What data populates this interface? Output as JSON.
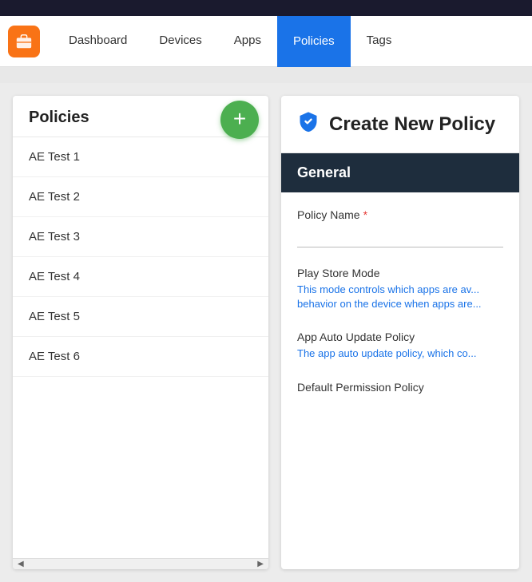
{
  "topbar": {
    "visible": true
  },
  "nav": {
    "logo_icon": "briefcase-icon",
    "links": [
      {
        "label": "Dashboard",
        "active": false
      },
      {
        "label": "Devices",
        "active": false
      },
      {
        "label": "Apps",
        "active": false
      },
      {
        "label": "Policies",
        "active": true
      },
      {
        "label": "Tags",
        "active": false
      }
    ]
  },
  "policies_panel": {
    "title": "Policies",
    "add_button_label": "+",
    "items": [
      {
        "label": "AE Test 1"
      },
      {
        "label": "AE Test 2"
      },
      {
        "label": "AE Test 3"
      },
      {
        "label": "AE Test 4"
      },
      {
        "label": "AE Test 5"
      },
      {
        "label": "AE Test 6"
      }
    ]
  },
  "create_policy": {
    "title": "Create New Policy",
    "section_general": "General",
    "field_policy_name_label": "Policy Name",
    "field_policy_name_required": "*",
    "field_policy_name_value": "",
    "field_play_store_mode_label": "Play Store Mode",
    "field_play_store_mode_description": "This mode controls which apps are av... behavior on the device when apps are...",
    "field_app_auto_update_label": "App Auto Update Policy",
    "field_app_auto_update_description": "The app auto update policy, which co...",
    "field_default_permission_label": "Default Permission Policy"
  },
  "colors": {
    "active_nav": "#1a73e8",
    "add_button": "#4caf50",
    "shield": "#1a73e8",
    "general_header": "#1e2d3d",
    "description_blue": "#1a73e8",
    "required": "#e53935"
  }
}
